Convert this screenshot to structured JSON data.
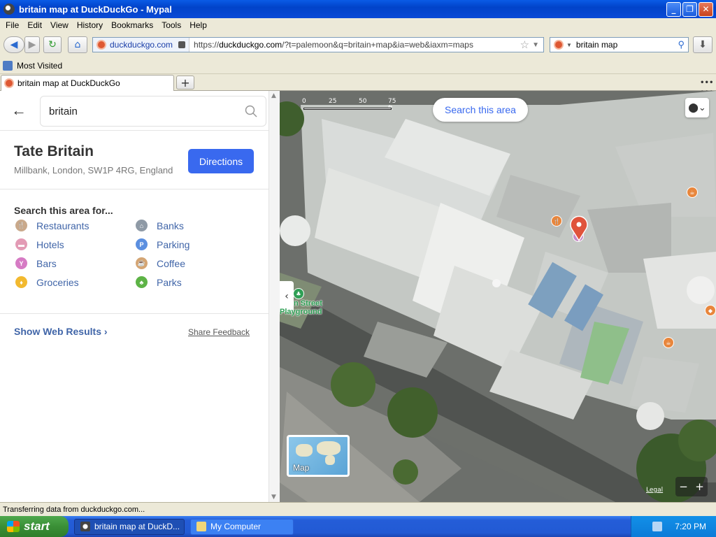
{
  "window": {
    "title": "britain map at DuckDuckGo - Mypal",
    "minimize_icon": "minimize-icon",
    "maximize_icon": "restore-icon",
    "close_icon": "close-icon"
  },
  "menu": [
    "File",
    "Edit",
    "View",
    "History",
    "Bookmarks",
    "Tools",
    "Help"
  ],
  "navbar": {
    "identity": "duckduckgo.com",
    "url_prefix": "https://",
    "url_domain": "duckduckgo.com",
    "url_rest": "/?t=palemoon&q=britain+map&ia=web&iaxm=maps",
    "search_value": "britain map"
  },
  "bookmarks": {
    "most_visited": "Most Visited"
  },
  "tab": {
    "title": "britain map at DuckDuckGo",
    "new_tab": "+"
  },
  "sidebar": {
    "query": "britain",
    "place_name": "Tate Britain",
    "place_address": "Millbank, London, SW1P 4RG, England",
    "directions": "Directions",
    "area_title": "Search this area for...",
    "categories": [
      {
        "label": "Restaurants",
        "color": "#c9a98b"
      },
      {
        "label": "Banks",
        "color": "#8f9aa6"
      },
      {
        "label": "Hotels",
        "color": "#e39bb5"
      },
      {
        "label": "Parking",
        "color": "#5b8fe0"
      },
      {
        "label": "Bars",
        "color": "#d67bc4"
      },
      {
        "label": "Coffee",
        "color": "#d4a574"
      },
      {
        "label": "Groceries",
        "color": "#f2b92f"
      },
      {
        "label": "Parks",
        "color": "#5db346"
      }
    ],
    "web_results": "Show Web Results",
    "feedback": "Share Feedback"
  },
  "map": {
    "scale_labels": [
      "0",
      "25",
      "50",
      "75 ft"
    ],
    "search_area": "Search this area",
    "street_label_1": "n Street",
    "street_label_2": "Playground",
    "maptype_label": "Map",
    "legal": "Legal",
    "zoom_out": "−",
    "zoom_in": "+"
  },
  "status": "Transferring data from duckduckgo.com...",
  "taskbar": {
    "start": "start",
    "tasks": [
      "britain map at DuckD...",
      "My Computer"
    ],
    "time": "7:20 PM"
  }
}
